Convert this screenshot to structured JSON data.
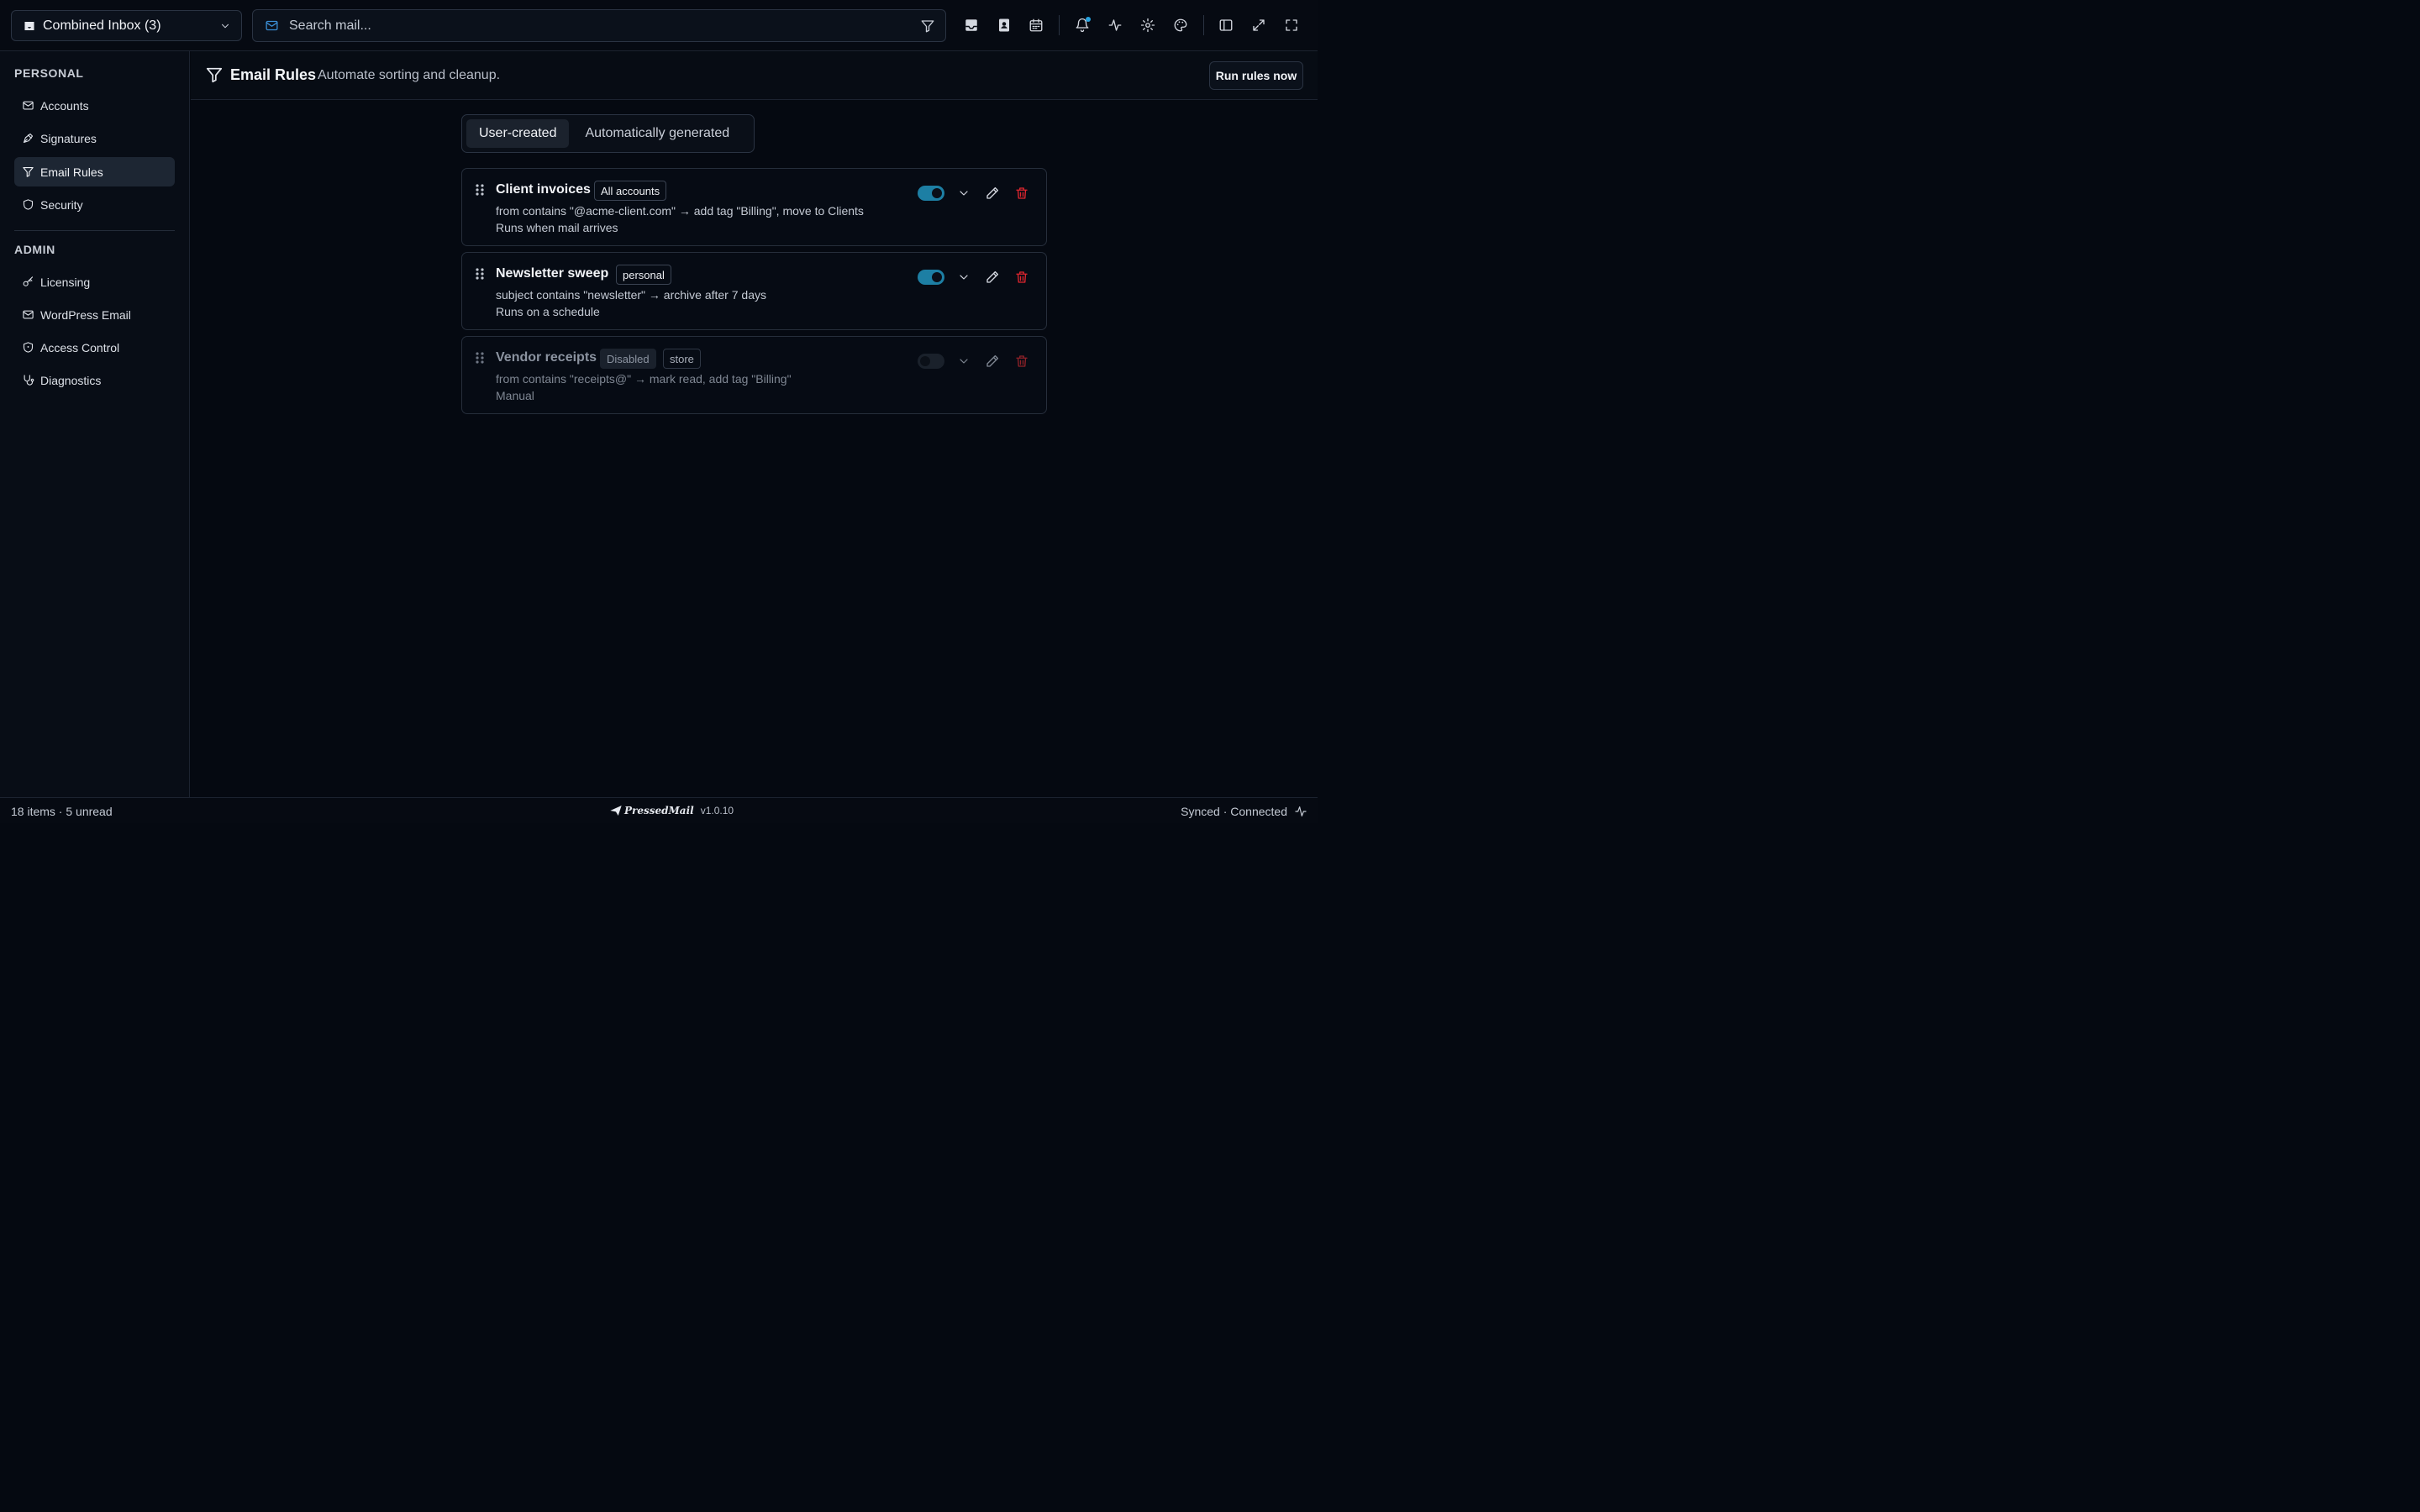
{
  "topbar": {
    "inbox_label": "Combined Inbox (3)",
    "search_placeholder": "Search mail..."
  },
  "sidebar": {
    "personal_title": "PERSONAL",
    "personal_items": [
      {
        "label": "Accounts",
        "icon": "mail-icon"
      },
      {
        "label": "Signatures",
        "icon": "pen-nib-icon"
      },
      {
        "label": "Email Rules",
        "icon": "filter-icon",
        "active": true
      },
      {
        "label": "Security",
        "icon": "shield-icon"
      }
    ],
    "admin_title": "ADMIN",
    "admin_items": [
      {
        "label": "Licensing",
        "icon": "key-icon"
      },
      {
        "label": "WordPress Email",
        "icon": "mail-icon"
      },
      {
        "label": "Access Control",
        "icon": "shield-icon"
      },
      {
        "label": "Diagnostics",
        "icon": "stethoscope-icon"
      }
    ]
  },
  "header": {
    "title": "Email Rules",
    "subtitle": "Automate sorting and cleanup.",
    "run_button": "Run rules now"
  },
  "tabs": [
    {
      "label": "User-created",
      "active": true
    },
    {
      "label": "Automatically generated",
      "active": false
    }
  ],
  "rules": [
    {
      "name": "Client invoices",
      "scope": "All accounts",
      "disabled_badge": "",
      "description": "from contains \"@acme-client.com\" → add tag \"Billing\", move to Clients",
      "trigger": "Runs when mail arrives",
      "enabled": true
    },
    {
      "name": "Newsletter sweep",
      "scope": "personal",
      "disabled_badge": "",
      "description": "subject contains \"newsletter\" → archive after 7 days",
      "trigger": "Runs on a schedule",
      "enabled": true
    },
    {
      "name": "Vendor receipts",
      "scope": "store",
      "disabled_badge": "Disabled",
      "description": "from contains \"receipts@\" → mark read, add tag \"Billing\"",
      "trigger": "Manual",
      "enabled": false
    }
  ],
  "footer": {
    "count": "18 items · 5 unread",
    "brand": "PressedMail",
    "version": "v1.0.10",
    "status": "Synced · Connected"
  },
  "colors": {
    "accent": "#1d7fa4",
    "danger": "#e0262f",
    "background": "#050911"
  }
}
